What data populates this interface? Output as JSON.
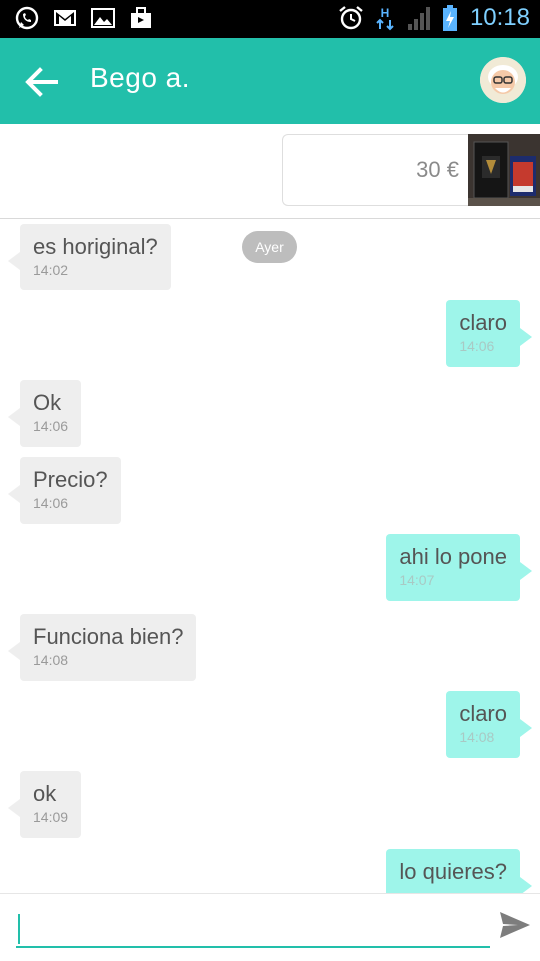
{
  "status_bar": {
    "time": "10:18",
    "left_icons": [
      "whatsapp-icon",
      "gmail-icon",
      "gallery-icon",
      "shop-bag-icon"
    ],
    "right_icons": [
      "alarm-icon",
      "hspa-icon",
      "signal-icon",
      "battery-charging-icon"
    ]
  },
  "header": {
    "title": "Bego a.",
    "back_icon": "arrow-left-icon",
    "avatar_icon": "avatar-face-icon"
  },
  "item": {
    "price": "30 €"
  },
  "chat": {
    "day_label": "Ayer",
    "messages": [
      {
        "dir": "in",
        "text": "es horiginal?",
        "time": "14:02"
      },
      {
        "dir": "out",
        "text": "claro",
        "time": "14:06"
      },
      {
        "dir": "in",
        "text": "Ok",
        "time": "14:06"
      },
      {
        "dir": "in",
        "text": "Precio?",
        "time": "14:06"
      },
      {
        "dir": "out",
        "text": "ahi lo pone",
        "time": "14:07"
      },
      {
        "dir": "in",
        "text": "Funciona bien?",
        "time": "14:08"
      },
      {
        "dir": "out",
        "text": "claro",
        "time": "14:08"
      },
      {
        "dir": "in",
        "text": "ok",
        "time": "14:09"
      },
      {
        "dir": "out",
        "text": "lo quieres?",
        "time": ""
      }
    ]
  },
  "composer": {
    "value": "",
    "placeholder": "",
    "send_icon": "send-icon"
  },
  "colors": {
    "accent": "#22bfaa",
    "bubble_out": "#9ef5ea",
    "bubble_in": "#eeeeee"
  }
}
